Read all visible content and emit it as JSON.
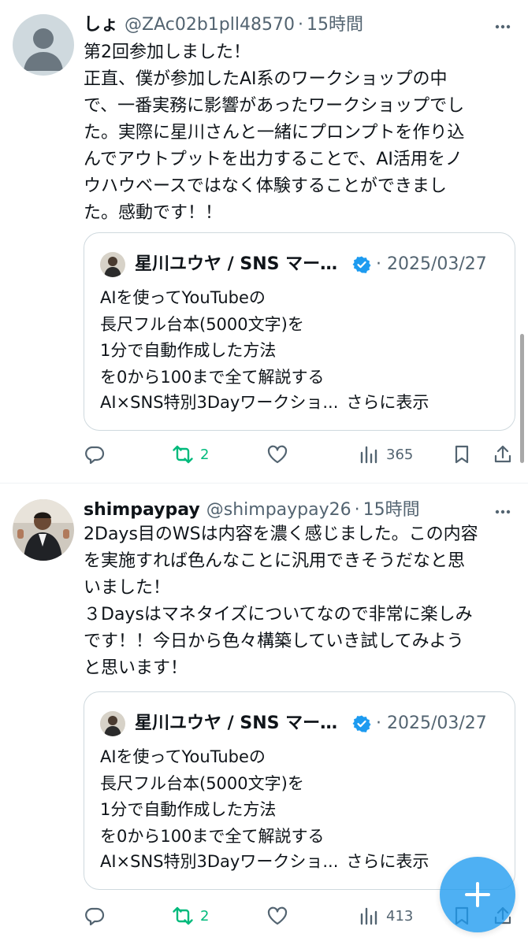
{
  "colors": {
    "accent": "#1d9bf0",
    "retweet_green": "#00ba7c",
    "secondary_text": "#536471",
    "verified_blue": "#1d9bf0"
  },
  "posts": [
    {
      "display_name": "しょ",
      "handle": "@ZAc02b1pll48570",
      "separator": "·",
      "time": "15時間",
      "text": "第2回参加しました！\n正直、僕が参加したAI系のワークショップの中\nで、一番実務に影響があったワークショップでし\nた。実際に星川さんと一緒にプロンプトを作り込\nんでアウトプットを出力することで、AI活用をノ\nウハウベースではなく体験することができまし\nた。感動です！！",
      "quote": {
        "author": "星川ユウヤ / SNS マー…",
        "separator": "·",
        "date": "2025/03/27",
        "text": "AIを使ってYouTubeの\n長尺フル台本(5000文字)を\n1分で自動作成した方法\nを0から100まで全て解説する",
        "last_line": "AI×SNS特別3Dayワークショ...",
        "show_more": "さらに表示"
      },
      "actions": {
        "reply_icon": "reply-icon",
        "retweet_icon": "retweet-icon",
        "retweets": "2",
        "like_icon": "heart-icon",
        "views_icon": "views-icon",
        "views": "365",
        "bookmark_icon": "bookmark-icon",
        "share_icon": "share-icon"
      }
    },
    {
      "display_name": "shimpaypay",
      "handle": "@shimpaypay26",
      "separator": "·",
      "time": "15時間",
      "text": "2Days目のWSは内容を濃く感じました。この内容\nを実施すれば色んなことに汎用できそうだなと思\nいました！\n３Daysはマネタイズについてなので非常に楽しみ\nです！！今日から色々構築していき試してみよう\nと思います！",
      "quote": {
        "author": "星川ユウヤ / SNS マー…",
        "separator": "·",
        "date": "2025/03/27",
        "text": "AIを使ってYouTubeの\n長尺フル台本(5000文字)を\n1分で自動作成した方法\nを0から100まで全て解説する",
        "last_line": "AI×SNS特別3Dayワークショ...",
        "show_more": "さらに表示"
      },
      "actions": {
        "reply_icon": "reply-icon",
        "retweet_icon": "retweet-icon",
        "retweets": "2",
        "like_icon": "heart-icon",
        "views_icon": "views-icon",
        "views": "413",
        "bookmark_icon": "bookmark-icon",
        "share_icon": "share-icon"
      }
    }
  ],
  "fab": {
    "icon": "plus-icon"
  }
}
